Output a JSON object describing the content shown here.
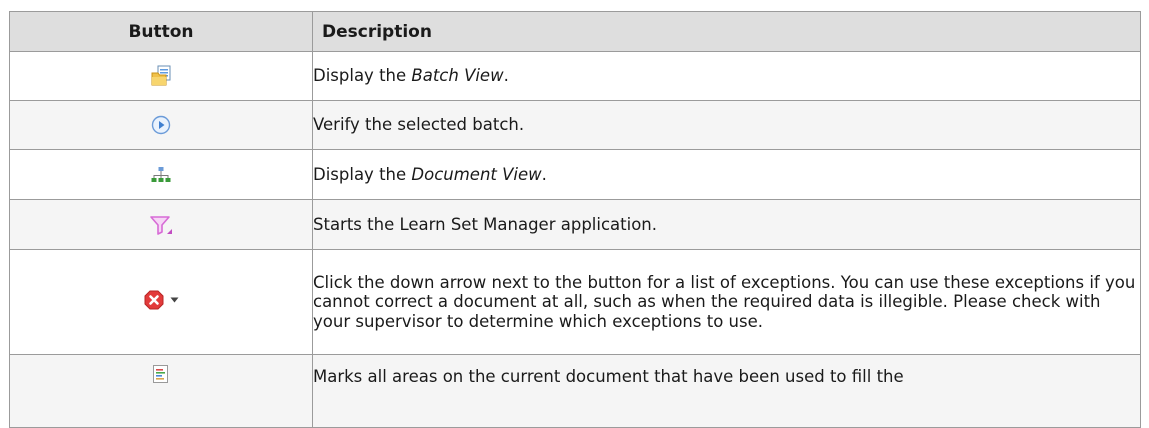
{
  "table": {
    "headers": {
      "button": "Button",
      "description": "Description"
    },
    "rows": [
      {
        "icon": "batch-view-icon",
        "desc_before": "Display the ",
        "desc_em": "Batch View",
        "desc_after": "."
      },
      {
        "icon": "verify-play-icon",
        "text": "Verify the selected batch."
      },
      {
        "icon": "document-tree-icon",
        "desc_before": "Display the ",
        "desc_em": "Document View",
        "desc_after": "."
      },
      {
        "icon": "funnel-icon",
        "text": "Starts the Learn Set Manager application."
      },
      {
        "icon": "error-x-icon",
        "text": "Click the down arrow next to the button for a list of exceptions. You can use these exceptions if you cannot correct a document at all, such as when the required data is illegible. Please check with your supervisor to determine which exceptions to use."
      },
      {
        "icon": "mark-areas-icon",
        "text": "Marks all areas on the current document that have been used to fill the"
      }
    ]
  },
  "colors": {
    "header_bg": "#dedede",
    "row_alt_bg": "#f5f5f5",
    "border": "#9b9b9b",
    "error_red": "#e23b3b",
    "funnel_pink": "#d76bd6",
    "tree_green": "#3a9a3a",
    "play_blue": "#3f7fd0"
  }
}
